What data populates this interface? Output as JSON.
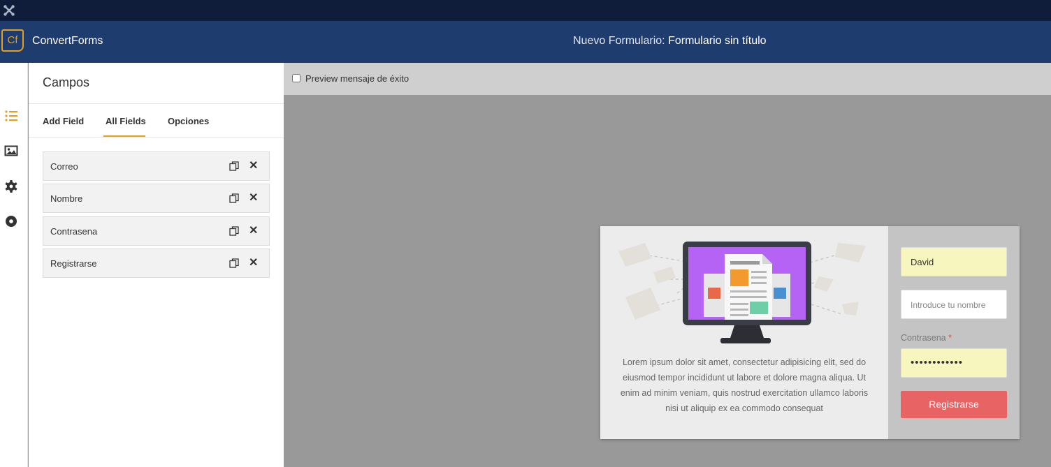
{
  "header": {
    "logo_mark": "Cf",
    "app_name": "ConvertForms",
    "form_title_prefix": "Nuevo Formulario:",
    "form_title": "Formulario sin título"
  },
  "sidebar_icons": [
    "list-icon",
    "image-icon",
    "gear-icon",
    "target-icon"
  ],
  "panel": {
    "title": "Campos",
    "tabs": [
      {
        "label": "Add Field",
        "active": false
      },
      {
        "label": "All Fields",
        "active": true
      },
      {
        "label": "Opciones",
        "active": false
      }
    ],
    "fields": [
      {
        "label": "Correo"
      },
      {
        "label": "Nombre"
      },
      {
        "label": "Contrasena"
      },
      {
        "label": "Registrarse"
      }
    ]
  },
  "preview": {
    "checkbox_label": "Preview mensaje de éxito",
    "checked": false
  },
  "form_preview": {
    "body_text": "Lorem ipsum dolor sit amet, consectetur adipisicing elit, sed do eiusmod tempor incididunt ut labore et dolore magna aliqua. Ut enim ad minim veniam, quis nostrud exercitation ullamco laboris nisi ut aliquip ex ea commodo consequat",
    "email_value": "David",
    "name_placeholder": "Introduce tu nombre",
    "password_label": "Contrasena",
    "required_mark": "*",
    "password_value": "••••••••••••",
    "submit_label": "Registrarse"
  },
  "colors": {
    "topbar": "#101d3a",
    "header": "#1f3c6e",
    "accent": "#e5a01a",
    "submit": "#e86464",
    "filled_input": "#f8f6bf",
    "illustration_screen": "#b463f5"
  }
}
